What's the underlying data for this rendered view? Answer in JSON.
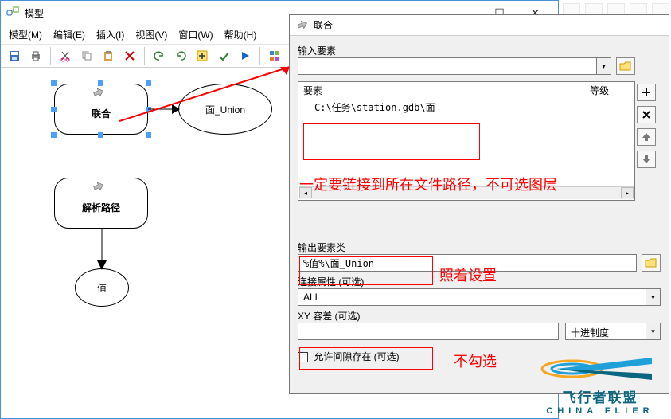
{
  "main_window": {
    "title": "模型",
    "menu": {
      "model": "模型(M)",
      "edit": "编辑(E)",
      "insert": "插入(I)",
      "view": "视图(V)",
      "window": "窗口(W)",
      "help": "帮助(H)"
    }
  },
  "canvas": {
    "node_union": "联合",
    "node_union_out": "面_Union",
    "node_parse": "解析路径",
    "node_value": "值"
  },
  "dialog": {
    "title": "联合",
    "input_label": "输入要素",
    "list_header_element": "要素",
    "list_header_rank": "等级",
    "list_row_path": "C:\\任务\\station.gdb\\面",
    "output_label": "输出要素类",
    "output_value": "%值%\\面_Union",
    "join_label": "连接属性 (可选)",
    "join_value": "ALL",
    "xy_label": "XY 容差 (可选)",
    "xy_unit": "十进制度",
    "gap_label": "允许间隙存在 (可选)"
  },
  "annotations": {
    "a1": "一定要链接到所在文件路径，不可选图层",
    "a2": "照着设置",
    "a3": "不勾选"
  },
  "watermark": {
    "cn": "飞行者联盟",
    "en": "CHINA FLIER"
  }
}
